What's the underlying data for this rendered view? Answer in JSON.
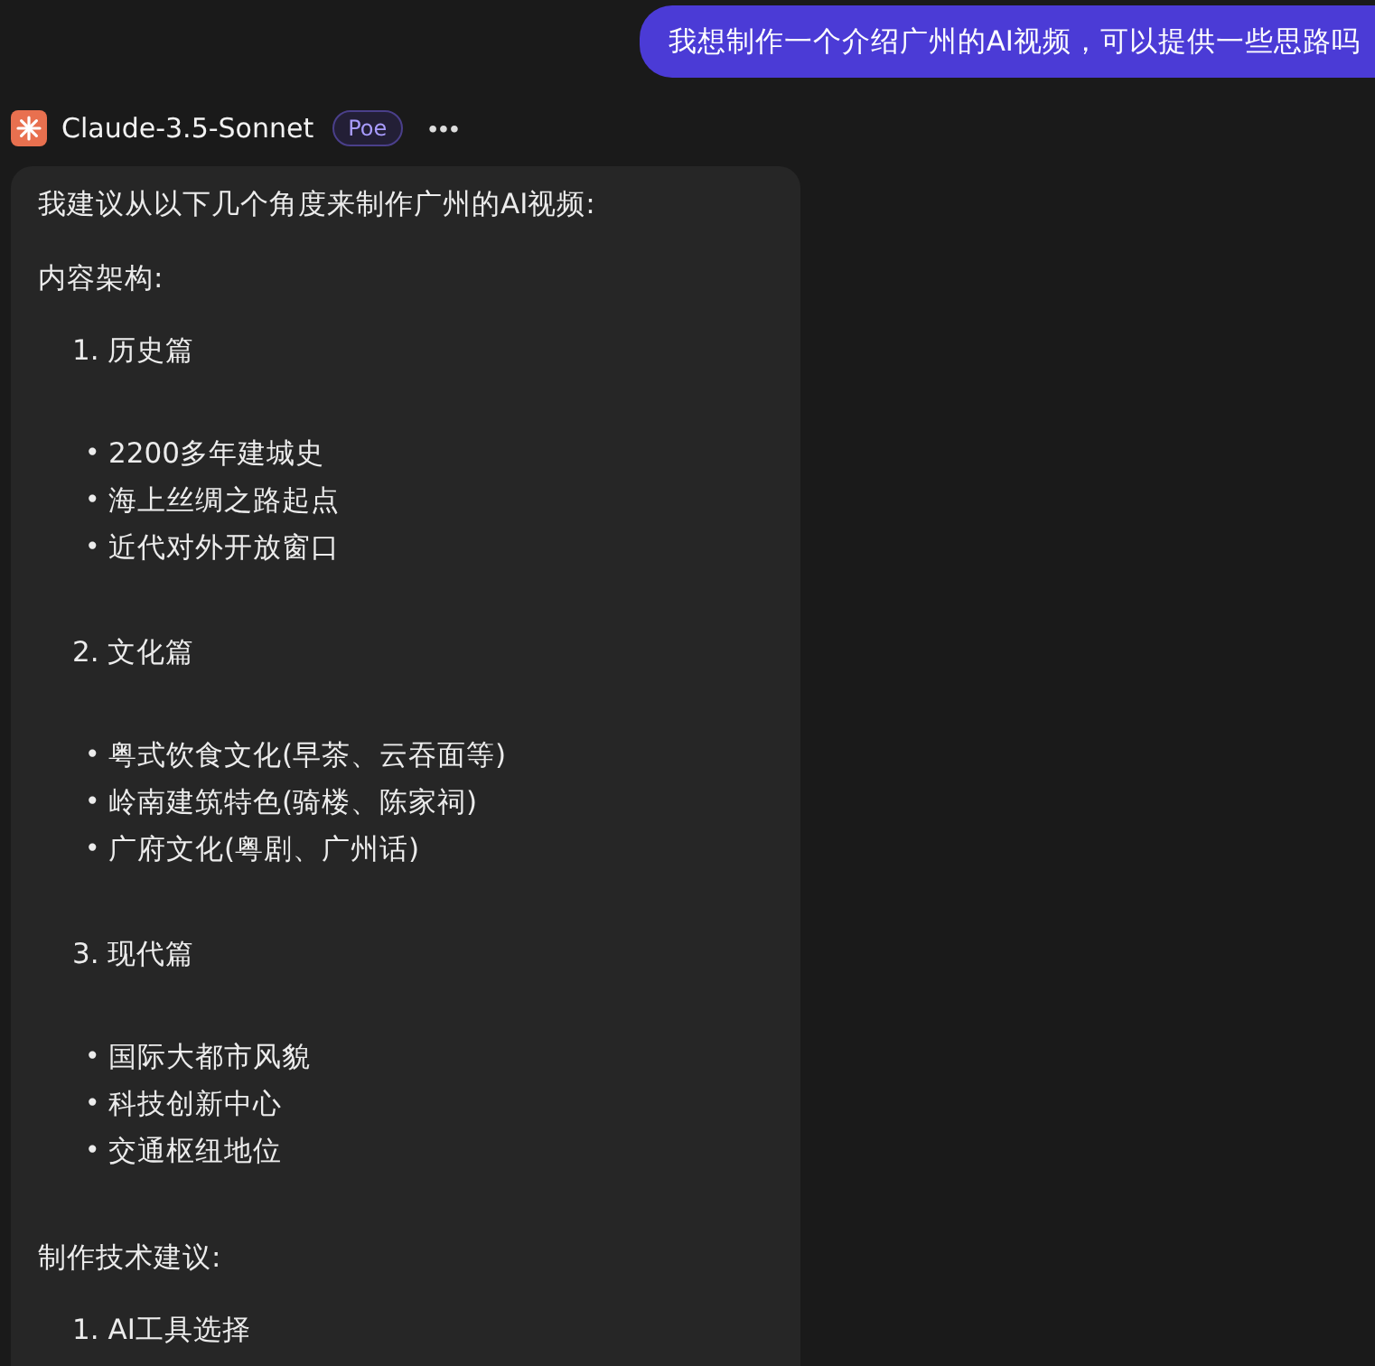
{
  "user_message": {
    "text": "我想制作一个介绍广州的AI视频，可以提供一些思路吗"
  },
  "bot": {
    "name": "Claude-3.5-Sonnet",
    "badge": "Poe",
    "menu": "•••"
  },
  "reply": {
    "intro": "我建议从以下几个角度来制作广州的AI视频:",
    "sections": [
      {
        "heading": "内容架构:",
        "items": [
          {
            "number": "1.",
            "title": "历史篇",
            "bullets": [
              "2200多年建城史",
              "海上丝绸之路起点",
              "近代对外开放窗口"
            ]
          },
          {
            "number": "2.",
            "title": "文化篇",
            "bullets": [
              "粤式饮食文化(早茶、云吞面等)",
              "岭南建筑特色(骑楼、陈家祠)",
              "广府文化(粤剧、广州话)"
            ]
          },
          {
            "number": "3.",
            "title": "现代篇",
            "bullets": [
              "国际大都市风貌",
              "科技创新中心",
              "交通枢纽地位"
            ]
          }
        ]
      },
      {
        "heading": "制作技术建议:",
        "items": [
          {
            "number": "1.",
            "title": "AI工具选择"
          }
        ]
      }
    ],
    "bullet_marker": "•"
  }
}
